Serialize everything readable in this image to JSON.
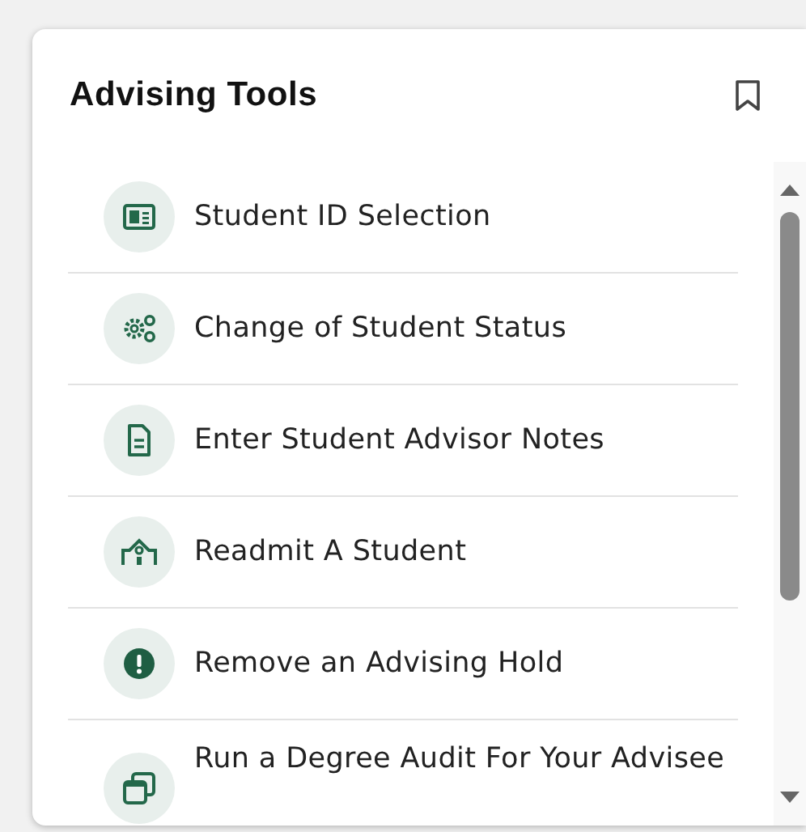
{
  "panel": {
    "title": "Advising Tools"
  },
  "tools": [
    {
      "kind": "id-card",
      "label": "Student ID Selection"
    },
    {
      "kind": "gears",
      "label": "Change of Student Status"
    },
    {
      "kind": "document",
      "label": "Enter Student Advisor Notes"
    },
    {
      "kind": "building",
      "label": "Readmit A Student"
    },
    {
      "kind": "alert",
      "label": "Remove an Advising Hold"
    },
    {
      "kind": "windows",
      "label": "Run a Degree Audit For Your Advisee"
    }
  ]
}
